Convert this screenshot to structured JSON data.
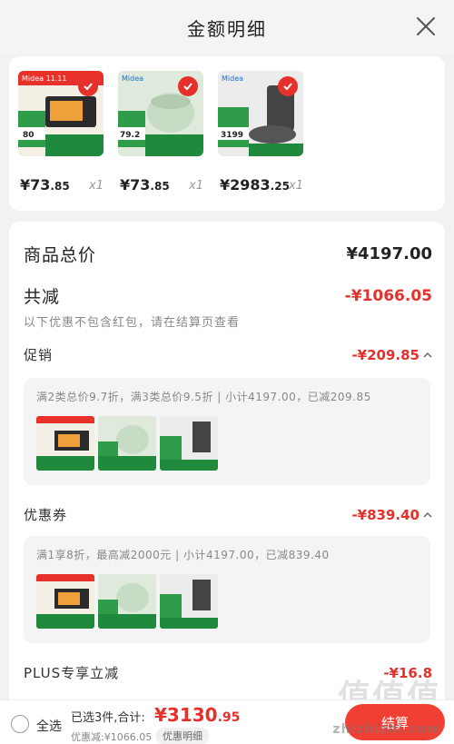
{
  "header": {
    "title": "金额明细"
  },
  "products": [
    {
      "price_int": "¥73",
      "price_dec": ".85",
      "qty": "x1",
      "badge": "Midea 11.11",
      "tag_price": "80"
    },
    {
      "price_int": "¥73",
      "price_dec": ".85",
      "qty": "x1",
      "badge": "Midea",
      "tag_price": "79.2"
    },
    {
      "price_int": "¥2983",
      "price_dec": ".25",
      "qty": "x1",
      "badge": "Midea",
      "tag_price": "3199"
    }
  ],
  "summary": {
    "goods_total_label": "商品总价",
    "goods_total_value": "¥4197.00",
    "total_reduce_label": "共减",
    "total_reduce_value": "-¥1066.05",
    "note": "以下优惠不包含红包，请在结算页查看",
    "promo_label": "促销",
    "promo_value": "-¥209.85",
    "promo_desc": "满2类总价9.7折，满3类总价9.5折 | 小计4197.00，已减209.85",
    "coupon_label": "优惠券",
    "coupon_value": "-¥839.40",
    "coupon_desc": "满1享8折，最高减2000元 | 小计4197.00，已减839.40",
    "plus_label": "PLUS专享立减",
    "plus_value": "-¥16.8"
  },
  "footer": {
    "select_all": "全选",
    "selected_info": "已选3件,合计:",
    "total_int": "¥3130",
    "total_dec": ".95",
    "discount_info": "优惠减:¥1066.05",
    "detail_pill": "优惠明细",
    "checkout": "结算"
  },
  "watermark": {
    "site": "zhizhizhi.com",
    "logo": "值值值"
  },
  "colors": {
    "accent": "#e5302b",
    "checkout": "#f14033"
  }
}
